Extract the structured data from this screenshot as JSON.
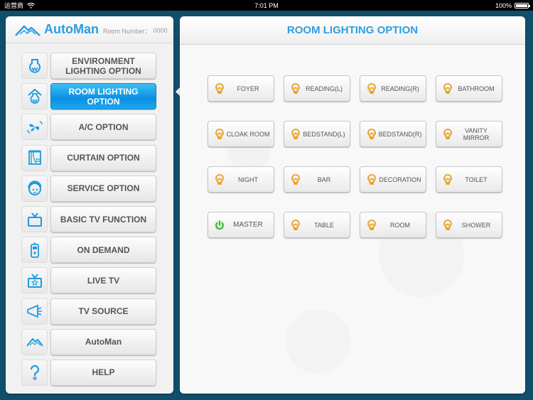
{
  "status_bar": {
    "carrier": "运营商",
    "time": "7:01 PM",
    "battery": "100%",
    "battery_level": 1.0
  },
  "left_header": {
    "brand": "AutoMan",
    "room_label": "Room Number：",
    "room_number": "0000"
  },
  "menu": {
    "items": [
      {
        "label": "ENVIRONMENT LIGHTING OPTION",
        "icon": "environment-bulb-icon",
        "active": false
      },
      {
        "label": "ROOM LIGHTING OPTION",
        "icon": "room-bulb-icon",
        "active": true
      },
      {
        "label": "A/C OPTION",
        "icon": "ac-fan-icon",
        "active": false
      },
      {
        "label": "CURTAIN OPTION",
        "icon": "curtain-icon",
        "active": false
      },
      {
        "label": "SERVICE OPTION",
        "icon": "service-face-icon",
        "active": false
      },
      {
        "label": "BASIC TV FUNCTION",
        "icon": "tv-icon",
        "active": false
      },
      {
        "label": "ON DEMAND",
        "icon": "remote-icon",
        "active": false
      },
      {
        "label": "LIVE TV",
        "icon": "live-tv-icon",
        "active": false
      },
      {
        "label": "TV SOURCE",
        "icon": "tv-source-icon",
        "active": false
      },
      {
        "label": "AutoMan",
        "icon": "automan-logo-icon",
        "active": false
      },
      {
        "label": "HELP",
        "icon": "help-icon",
        "active": false
      }
    ]
  },
  "main": {
    "title": "ROOM LIGHTING OPTION",
    "lights": [
      {
        "label": "FOYER",
        "icon": "bulb-icon"
      },
      {
        "label": "READING(L)",
        "icon": "bulb-icon"
      },
      {
        "label": "READING(R)",
        "icon": "bulb-icon"
      },
      {
        "label": "BATHROOM",
        "icon": "bulb-icon"
      },
      {
        "label": "CLOAK ROOM",
        "icon": "bulb-icon"
      },
      {
        "label": "BEDSTAND(L)",
        "icon": "bulb-icon"
      },
      {
        "label": "BEDSTAND(R)",
        "icon": "bulb-icon"
      },
      {
        "label": "VANITY MIRROR",
        "icon": "bulb-icon"
      },
      {
        "label": "NIGHT",
        "icon": "bulb-icon"
      },
      {
        "label": "BAR",
        "icon": "bulb-icon"
      },
      {
        "label": "DECORATION",
        "icon": "bulb-icon"
      },
      {
        "label": "TOILET",
        "icon": "bulb-icon"
      },
      {
        "label": "MASTER",
        "icon": "power-icon"
      },
      {
        "label": "TABLE",
        "icon": "bulb-icon"
      },
      {
        "label": "ROOM",
        "icon": "bulb-icon"
      },
      {
        "label": "SHOWER",
        "icon": "bulb-icon"
      }
    ]
  },
  "colors": {
    "accent": "#2e9ee0",
    "bulb": "#e8a020",
    "power": "#3cb83c",
    "background": "#0f4f6c"
  }
}
